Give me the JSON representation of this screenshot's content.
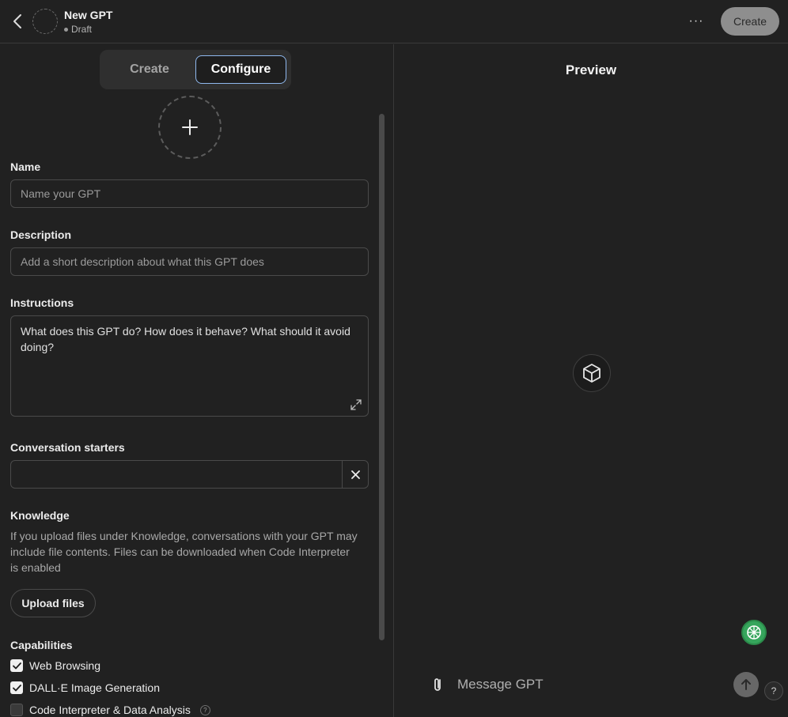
{
  "header": {
    "title": "New GPT",
    "status": "Draft",
    "more_label": "···",
    "create_button": "Create"
  },
  "tabs": {
    "create": "Create",
    "configure": "Configure",
    "active": "Configure"
  },
  "form": {
    "name": {
      "label": "Name",
      "value": "",
      "placeholder": "Name your GPT"
    },
    "description": {
      "label": "Description",
      "value": "",
      "placeholder": "Add a short description about what this GPT does"
    },
    "instructions": {
      "label": "Instructions",
      "value": "",
      "placeholder": "What does this GPT do? How does it behave? What should it avoid doing?"
    },
    "starters": {
      "label": "Conversation starters",
      "value": ""
    },
    "knowledge": {
      "label": "Knowledge",
      "description": "If you upload files under Knowledge, conversations with your GPT may include file contents. Files can be downloaded when Code Interpreter is enabled",
      "upload_button": "Upload files"
    },
    "capabilities": {
      "label": "Capabilities",
      "items": [
        {
          "label": "Web Browsing",
          "checked": true
        },
        {
          "label": "DALL·E Image Generation",
          "checked": true
        },
        {
          "label": "Code Interpreter & Data Analysis",
          "checked": false,
          "help": "?"
        }
      ]
    }
  },
  "preview": {
    "title": "Preview",
    "message_placeholder": "Message GPT",
    "help_label": "?"
  },
  "colors": {
    "background": "#212121",
    "accent_border": "#8fb8ee",
    "extension_badge": "#36a55c"
  }
}
